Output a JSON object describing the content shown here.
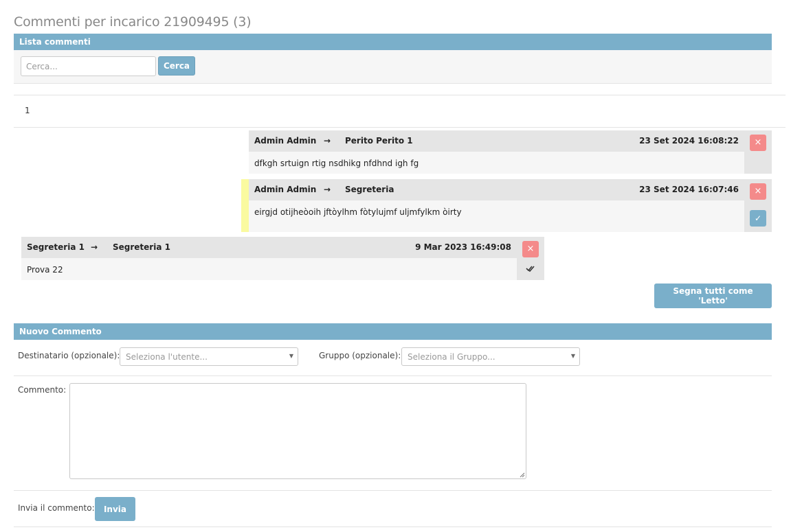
{
  "page": {
    "title": "Commenti per incarico 21909495 (3)"
  },
  "list": {
    "header": "Lista commenti",
    "search_placeholder": "Cerca...",
    "search_button": "Cerca",
    "page_number": "1"
  },
  "comments": [
    {
      "from": "Admin Admin",
      "to": "Perito Perito 1",
      "date": "23 Set 2024 16:08:22",
      "text": "dfkgh srtuign rtig nsdhikg nfdhnd igh fg",
      "delete_glyph": "×"
    },
    {
      "from": "Admin Admin",
      "to": "Segreteria",
      "date": "23 Set 2024 16:07:46",
      "text": "eirgjd otijheòoih jftòylhm fòtylujmf uljmfylkm òirty",
      "delete_glyph": "×",
      "check_glyph": "✓"
    },
    {
      "from": "Segreteria 1",
      "to": "Segreteria 1",
      "date": "9 Mar 2023 16:49:08",
      "text": "Prova 22",
      "delete_glyph": "×"
    }
  ],
  "arrow_glyph": "→",
  "mark_all_button": "Segna tutti come 'Letto'",
  "new_comment": {
    "header": "Nuovo Commento",
    "recipient_label": "Destinatario (opzionale):",
    "recipient_placeholder": "Seleziona l'utente...",
    "group_label": "Gruppo (opzionale):",
    "group_placeholder": "Seleziona il Gruppo...",
    "comment_label": "Commento:",
    "send_label": "Invia il commento:",
    "send_button": "Invia"
  },
  "colors": {
    "accent": "#7aafca",
    "delete": "#f48a8a",
    "unread_marker": "#fafaa0",
    "comment_header": "#e5e5e5"
  },
  "icons": {
    "caret": "caret-down-icon",
    "delete": "close-icon",
    "check": "check-icon",
    "double_check": "double-check-icon"
  }
}
